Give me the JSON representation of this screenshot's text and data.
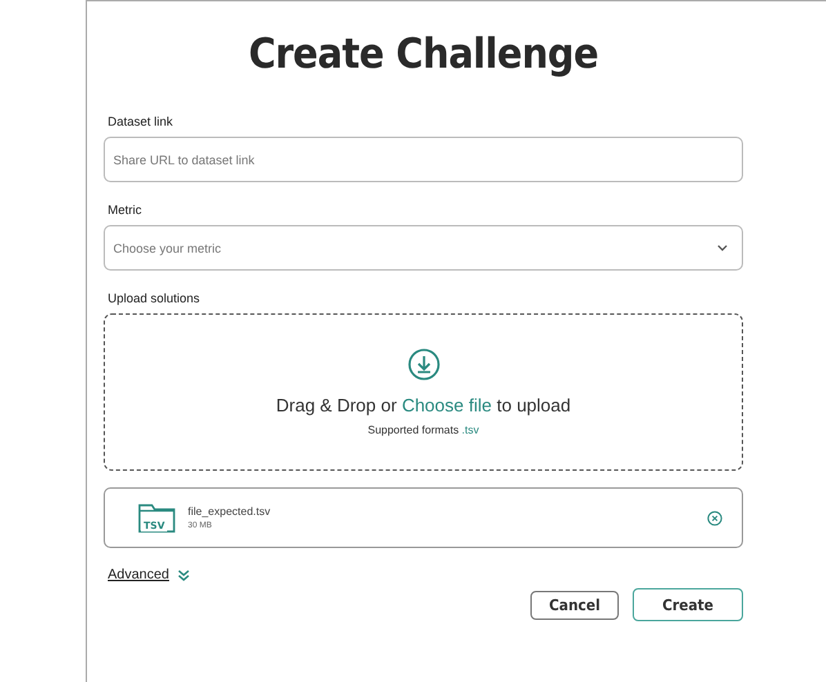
{
  "title": "Create Challenge",
  "dataset": {
    "label": "Dataset link",
    "placeholder": "Share URL to dataset link"
  },
  "metric": {
    "label": "Metric",
    "placeholder": "Choose your metric"
  },
  "upload": {
    "label": "Upload solutions",
    "prompt_before": "Drag & Drop or",
    "link": "Choose file",
    "prompt_after": "to upload",
    "formats_label": "Supported formats",
    "formats": ".tsv"
  },
  "file": {
    "badge": "TSV",
    "name": "file_expected.tsv",
    "size": "30 MB"
  },
  "advanced": {
    "label": "Advanced",
    "expanded": false
  },
  "buttons": [
    {
      "label": "Cancel",
      "kind": "secondary"
    },
    {
      "label": "Create",
      "kind": "primary"
    }
  ]
}
